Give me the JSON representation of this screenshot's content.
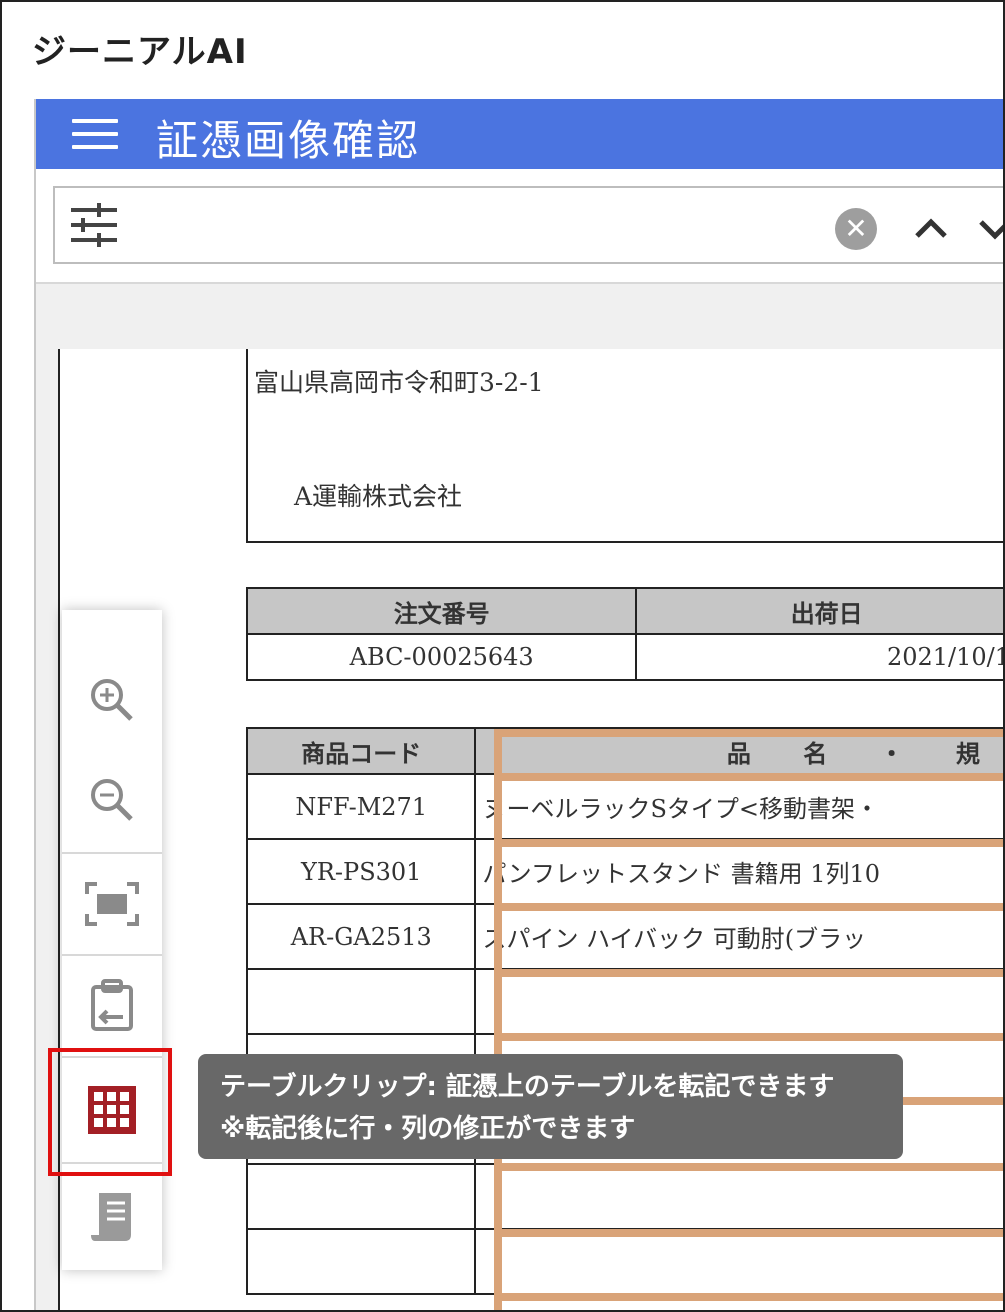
{
  "app": {
    "title": "ジーニアルAI"
  },
  "header": {
    "title": "証憑画像確認",
    "color": "#4b74e0"
  },
  "search": {
    "value": ""
  },
  "document": {
    "address": "富山県高岡市令和町3-2-1",
    "company": "A運輸株式会社",
    "order_table": {
      "headers": [
        "注文番号",
        "出荷日"
      ],
      "row": [
        "ABC-00025643",
        "2021/10/1"
      ]
    },
    "items_table": {
      "headers": [
        "商品コード",
        "品 名 ・ 規"
      ],
      "rows": [
        [
          "NFF-M271",
          "ヌーベルラックSタイプ<移動書架・"
        ],
        [
          "YR-PS301",
          "パンフレットスタンド 書籍用 1列10"
        ],
        [
          "AR-GA2513",
          "スパイン ハイバック 可動肘(ブラッ"
        ],
        [
          "",
          ""
        ],
        [
          "",
          ""
        ],
        [
          "",
          ""
        ],
        [
          "",
          ""
        ],
        [
          "",
          ""
        ]
      ]
    }
  },
  "toolbar": {
    "items": [
      {
        "name": "zoom-in-icon"
      },
      {
        "name": "zoom-out-icon"
      },
      {
        "name": "fit-screen-icon"
      },
      {
        "name": "clipboard-icon"
      },
      {
        "name": "table-clip-icon",
        "active_color": "#a31f25",
        "highlight_color": "#e01010"
      },
      {
        "name": "receipt-icon"
      }
    ]
  },
  "tooltip": {
    "line1": "テーブルクリップ: 証憑上のテーブルを転記できます",
    "line2": "※転記後に行・列の修正ができます"
  }
}
